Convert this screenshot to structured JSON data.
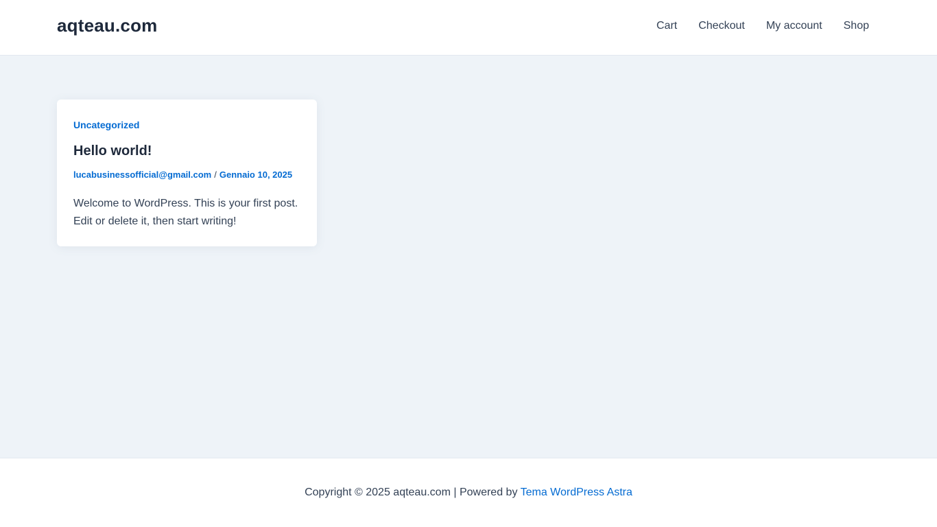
{
  "header": {
    "site_title": "aqteau.com",
    "nav": [
      {
        "label": "Cart"
      },
      {
        "label": "Checkout"
      },
      {
        "label": "My account"
      },
      {
        "label": "Shop"
      }
    ]
  },
  "post": {
    "category": "Uncategorized",
    "title": "Hello world!",
    "author": "lucabusinessofficial@gmail.com",
    "separator": "/",
    "date": "Gennaio 10, 2025",
    "excerpt": "Welcome to WordPress. This is your first post. Edit or delete it, then start writing!"
  },
  "footer": {
    "copyright": "Copyright © 2025 aqteau.com | Powered by ",
    "theme_link": "Tema WordPress Astra"
  },
  "colors": {
    "accent": "#046bd2",
    "heading": "#1e293b",
    "text": "#334155",
    "background": "#eef3f8"
  }
}
